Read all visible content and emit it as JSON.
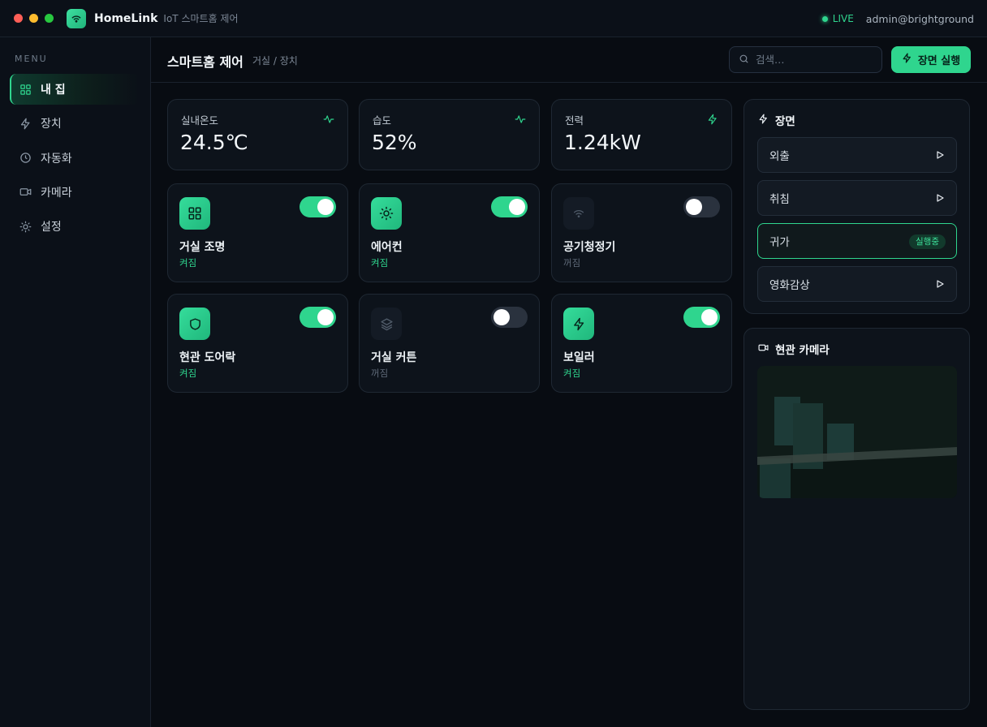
{
  "titlebar": {
    "app_name": "HomeLink",
    "app_subtitle": "IoT 스마트홈 제어",
    "live_label": "LIVE",
    "user": "admin@brightground"
  },
  "sidebar": {
    "menu_label": "MENU",
    "items": [
      {
        "label": "내 집",
        "icon": "grid-icon",
        "active": true
      },
      {
        "label": "장치",
        "icon": "bolt-icon",
        "active": false
      },
      {
        "label": "자동화",
        "icon": "clock-icon",
        "active": false
      },
      {
        "label": "카메라",
        "icon": "camera-icon",
        "active": false
      },
      {
        "label": "설정",
        "icon": "sun-gear-icon",
        "active": false
      }
    ]
  },
  "header": {
    "title": "스마트홈 제어",
    "breadcrumb": "거실 / 장치",
    "search_placeholder": "검색…",
    "run_button": "장면 실행"
  },
  "stats": [
    {
      "label": "실내온도",
      "value": "24.5℃",
      "icon": "pulse-icon"
    },
    {
      "label": "습도",
      "value": "52%",
      "icon": "pulse-icon"
    },
    {
      "label": "전력",
      "value": "1.24kW",
      "icon": "bolt-icon"
    }
  ],
  "devices": [
    {
      "name": "거실 조명",
      "state": "켜짐",
      "on": true,
      "icon": "grid-icon"
    },
    {
      "name": "에어컨",
      "state": "켜짐",
      "on": true,
      "icon": "sun-icon"
    },
    {
      "name": "공기청정기",
      "state": "꺼짐",
      "on": false,
      "icon": "wifi-icon"
    },
    {
      "name": "현관 도어락",
      "state": "켜짐",
      "on": true,
      "icon": "shield-icon"
    },
    {
      "name": "거실 커튼",
      "state": "꺼짐",
      "on": false,
      "icon": "layers-icon"
    },
    {
      "name": "보일러",
      "state": "켜짐",
      "on": true,
      "icon": "bolt-icon"
    }
  ],
  "scenes": {
    "title": "장면",
    "items": [
      {
        "label": "외출",
        "running": false
      },
      {
        "label": "취침",
        "running": false
      },
      {
        "label": "귀가",
        "running": true,
        "badge": "실행중"
      },
      {
        "label": "영화감상",
        "running": false
      }
    ]
  },
  "camera": {
    "title": "현관 카메라"
  },
  "colors": {
    "accent": "#2fd58e",
    "background": "#080c12",
    "card": "#0d131b"
  }
}
